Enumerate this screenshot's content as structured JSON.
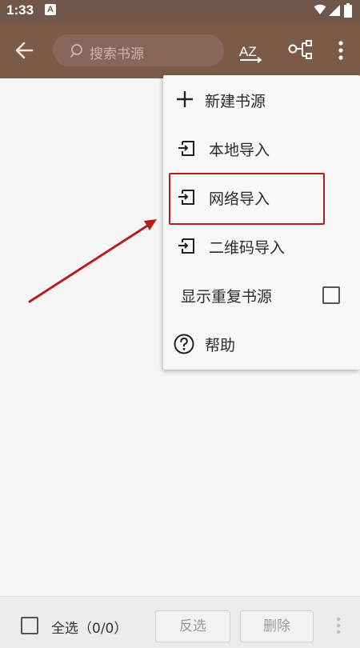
{
  "status": {
    "time": "1:33",
    "notification_letter": "A"
  },
  "toolbar": {
    "search_placeholder": "搜索书源",
    "sort_label": "AZ"
  },
  "menu": {
    "items": [
      {
        "label": "新建书源",
        "icon": "plus-icon"
      },
      {
        "label": "本地导入",
        "icon": "import-icon"
      },
      {
        "label": "网络导入",
        "icon": "import-icon"
      },
      {
        "label": "二维码导入",
        "icon": "import-icon"
      },
      {
        "label": "显示重复书源",
        "checked": false
      },
      {
        "label": "帮助",
        "icon": "help-icon"
      }
    ]
  },
  "bottom": {
    "select_all_label": "全选（0/0）",
    "invert_label": "反选",
    "delete_label": "删除"
  },
  "colors": {
    "primary": "#7b5a48",
    "status_bar": "#70574a",
    "annotation_red": "#b51c1c"
  }
}
